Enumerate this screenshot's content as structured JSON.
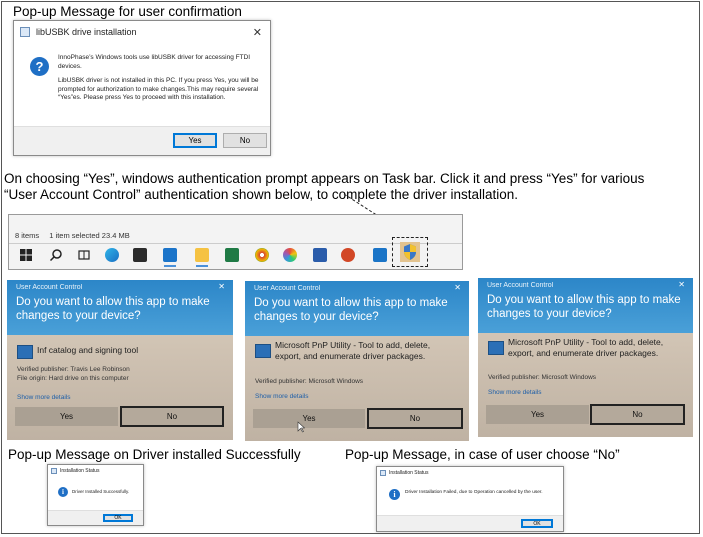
{
  "captions": {
    "top": "Pop-up Message for user confirmation",
    "middle_line1": "On choosing “Yes”, windows authentication prompt appears on Task bar. Click it and press “Yes” for various",
    "middle_line2": "“User Account Control”  authentication shown below, to complete the driver installation.",
    "bottom_left": "Pop-up Message on Driver installed Successfully",
    "bottom_right": "Pop-up Message, in case of user choose “No”"
  },
  "confirm_dialog": {
    "title": "libUSBK drive installation",
    "line1": "InnoPhase’s Windows tools use libUSBK driver for accessing FTDI devices.",
    "line2": "LibUSBK driver is not installed in this PC. If you press Yes, you will be prompted for authorization to make changes.This may require several “Yes”es. Please press Yes to proceed with this installation.",
    "yes_label": "Yes",
    "no_label": "No"
  },
  "taskbar": {
    "items_count": "8 items",
    "selection": "1 item selected  23.4 MB"
  },
  "uac_dialogs": [
    {
      "header": "User Account Control",
      "question": "Do you want to allow this app to make changes to your device?",
      "app_name": "Inf catalog and signing tool",
      "publisher": "Verified publisher: Travis Lee Robinson",
      "origin": "File origin: Hard drive on this computer",
      "more": "Show more details",
      "yes": "Yes",
      "no": "No"
    },
    {
      "header": "User Account Control",
      "question": "Do you want to allow this app to make changes to your device?",
      "app_name": "Microsoft PnP Utility - Tool to add, delete, export, and enumerate driver packages.",
      "publisher": "Verified publisher: Microsoft Windows",
      "origin": "",
      "more": "Show more details",
      "yes": "Yes",
      "no": "No"
    },
    {
      "header": "User Account Control",
      "question": "Do you want to allow this app to make changes to your device?",
      "app_name": "Microsoft PnP Utility - Tool to add, delete, export, and enumerate driver packages.",
      "publisher": "Verified publisher: Microsoft Windows",
      "origin": "",
      "more": "Show more details",
      "yes": "Yes",
      "no": "No"
    }
  ],
  "success_dialog": {
    "title": "Installation Status",
    "message": "Driver Installed Successfully.",
    "ok": "OK"
  },
  "failure_dialog": {
    "title": "Installation Status",
    "message": "Driver Installation Failed, due to Operation cancelled by the user.",
    "ok": "OK"
  }
}
